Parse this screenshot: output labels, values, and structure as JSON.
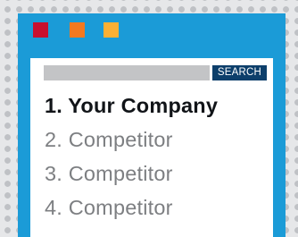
{
  "window_controls": [
    {
      "name": "red-square",
      "color": "#c8102e"
    },
    {
      "name": "orange-square",
      "color": "#f4791f"
    },
    {
      "name": "yellow-square",
      "color": "#fbb034"
    }
  ],
  "search": {
    "value": "",
    "placeholder": "",
    "button_label": "SEARCH"
  },
  "results": [
    {
      "label": "1. Your Company"
    },
    {
      "label": "2. Competitor"
    },
    {
      "label": "3. Competitor"
    },
    {
      "label": "4. Competitor"
    }
  ],
  "colors": {
    "window_frame": "#1b9bd7",
    "search_button": "#0d3f6b",
    "search_field": "#c3c4c6",
    "background_dots": "#bfc1c5"
  }
}
